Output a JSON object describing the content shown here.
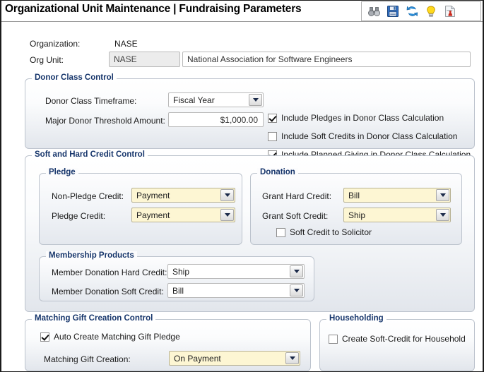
{
  "window": {
    "title": "Organizational Unit Maintenance | Fundraising Parameters"
  },
  "toolbar": {
    "icons": [
      {
        "name": "binoculars-search-icon",
        "label": "Search"
      },
      {
        "name": "floppy-save-icon",
        "label": "Save"
      },
      {
        "name": "refresh-icon",
        "label": "Refresh"
      },
      {
        "name": "lightbulb-hint-icon",
        "label": "Hint"
      },
      {
        "name": "report-document-icon",
        "label": "Report"
      }
    ]
  },
  "header": {
    "organization_label": "Organization:",
    "organization_value": "NASE",
    "org_unit_label": "Org Unit:",
    "org_unit_code": "NASE",
    "org_unit_name": "National Association for Software Engineers"
  },
  "donor_class_control": {
    "legend": "Donor Class Control",
    "timeframe_label": "Donor Class Timeframe:",
    "timeframe_value": "Fiscal Year",
    "threshold_label": "Major Donor Threshold Amount:",
    "threshold_value": "$1,000.00",
    "checkboxes": [
      {
        "label": "Include Pledges in Donor Class Calculation",
        "checked": true
      },
      {
        "label": "Include Soft Credits in Donor Class Calculation",
        "checked": false
      },
      {
        "label": "Include Planned Giving in Donor Class Calculation",
        "checked": true
      }
    ]
  },
  "soft_hard_credit_control": {
    "legend": "Soft and Hard Credit Control",
    "pledge": {
      "legend": "Pledge",
      "non_pledge_credit_label": "Non-Pledge Credit:",
      "non_pledge_credit_value": "Payment",
      "pledge_credit_label": "Pledge Credit:",
      "pledge_credit_value": "Payment"
    },
    "donation": {
      "legend": "Donation",
      "grant_hard_credit_label": "Grant Hard Credit:",
      "grant_hard_credit_value": "Bill",
      "grant_soft_credit_label": "Grant Soft Credit:",
      "grant_soft_credit_value": "Ship",
      "solicitor_checkbox_label": "Soft Credit to Solicitor",
      "solicitor_checkbox_checked": false
    },
    "membership_products": {
      "legend": "Membership Products",
      "hard_credit_label": "Member Donation Hard Credit:",
      "hard_credit_value": "Ship",
      "soft_credit_label": "Member Donation Soft Credit:",
      "soft_credit_value": "Bill"
    }
  },
  "matching_gift_creation_control": {
    "legend": "Matching Gift Creation Control",
    "auto_create_label": "Auto Create Matching Gift Pledge",
    "auto_create_checked": true,
    "creation_label": "Matching Gift Creation:",
    "creation_value": "On Payment"
  },
  "householding": {
    "legend": "Householding",
    "checkbox_label": "Create Soft-Credit for Household",
    "checkbox_checked": false
  },
  "colors": {
    "legend_text": "#16356b",
    "group_border": "#bcc3cd",
    "required_field": "#fdf6d3",
    "readonly_field": "#ececec"
  }
}
